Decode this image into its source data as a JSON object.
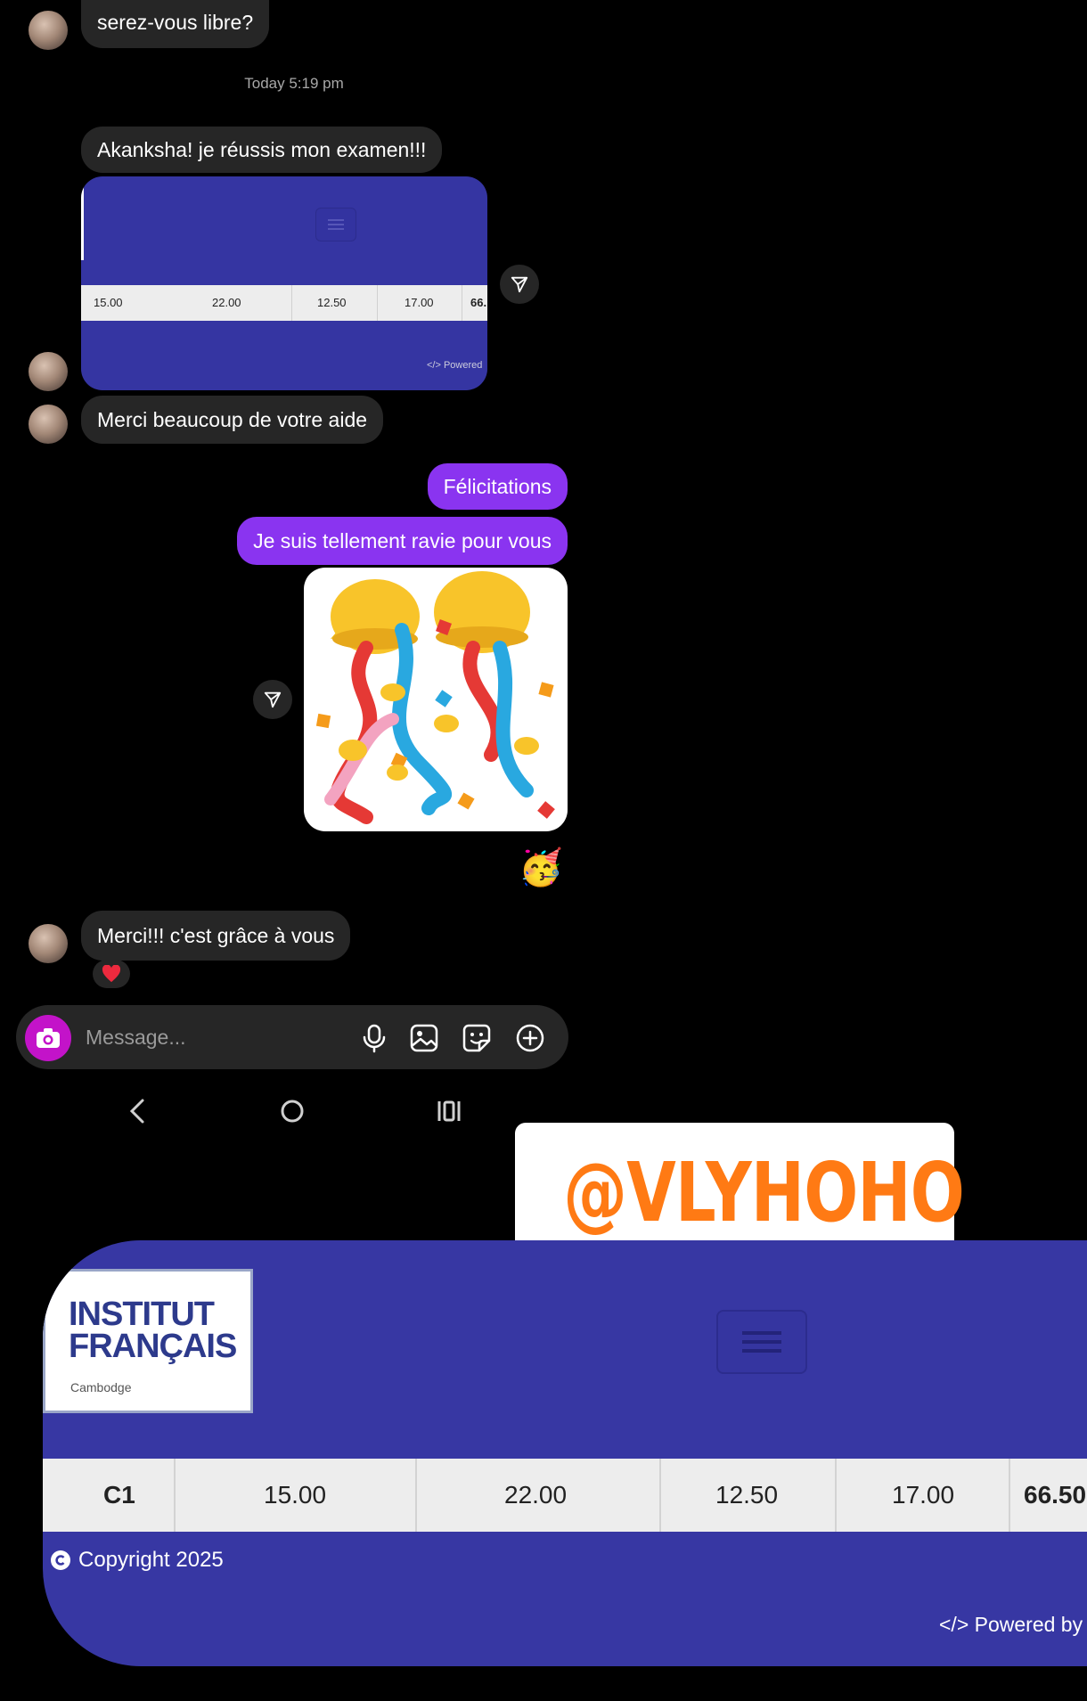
{
  "thread": {
    "msg1": "serez-vous libre?",
    "timestamp": "Today 5:19 pm",
    "msg2": "Akanksha! je réussis mon examen!!!",
    "shared_card": {
      "row_values": [
        "15.00",
        "22.00",
        "12.50",
        "17.00",
        "66."
      ],
      "powered": "</> Powered"
    },
    "msg3": "Merci beaucoup de votre aide",
    "out1": "Félicitations",
    "out2": "Je suis tellement ravie pour vous",
    "sticker_emoji": "🥳",
    "msg4": "Merci!!! c'est grâce à vous",
    "reaction": "❤️"
  },
  "composer": {
    "placeholder": "Message..."
  },
  "banner": {
    "handle": "@VLYHOHO"
  },
  "result_card": {
    "logo_line1": "INSTITUT",
    "logo_line2": "FRANÇAIS",
    "logo_line3": "Cambodge",
    "row": [
      "C1",
      "15.00",
      "22.00",
      "12.50",
      "17.00",
      "66.50"
    ],
    "copyright": "Copyright 2025",
    "powered": "</> Powered by"
  },
  "colors": {
    "outgoing_bubble": "#8a34f0",
    "incoming_bubble": "#262626",
    "card_blue": "#3737a3",
    "banner_text": "#ff7a14",
    "camera_button": "#c313c9"
  },
  "icons": [
    "share-icon",
    "camera-icon",
    "microphone-icon",
    "gallery-icon",
    "sticker-icon",
    "add-icon",
    "back-nav-icon",
    "home-nav-icon",
    "recents-nav-icon",
    "copyright-icon"
  ]
}
